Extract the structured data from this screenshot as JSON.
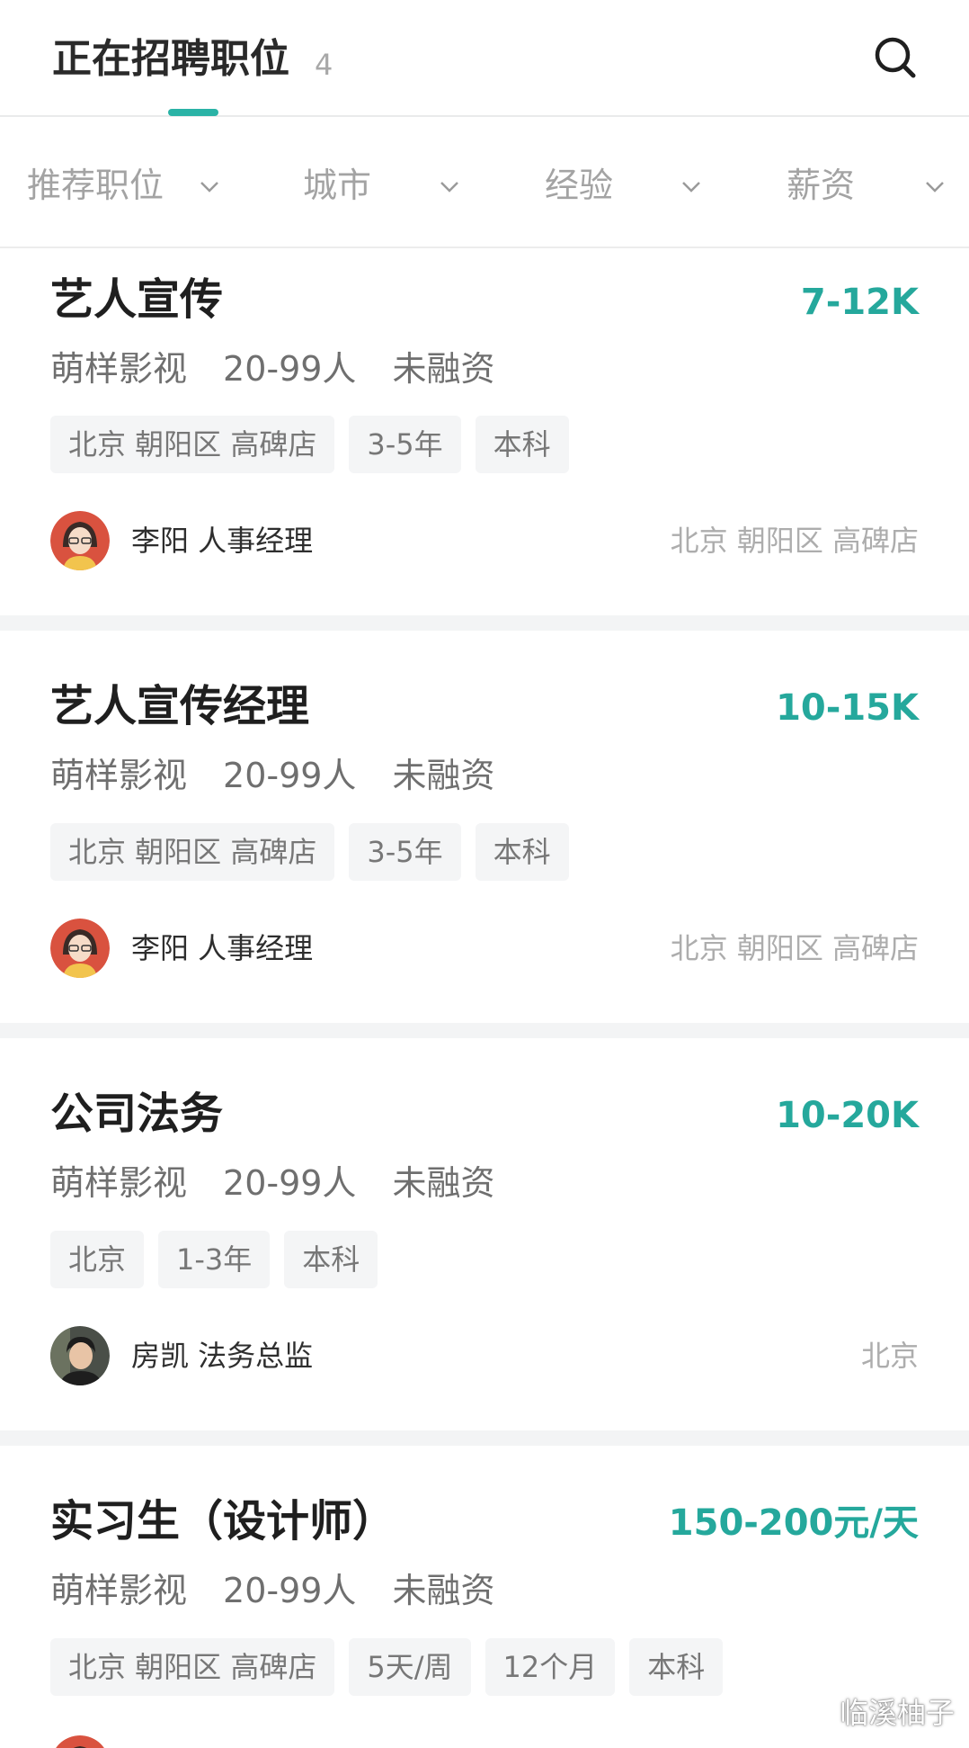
{
  "header": {
    "title": "正在招聘职位",
    "count": "4"
  },
  "filters": [
    {
      "label": "推荐职位"
    },
    {
      "label": "城市"
    },
    {
      "label": "经验"
    },
    {
      "label": "薪资"
    }
  ],
  "jobs": [
    {
      "title": "艺人宣传",
      "salary": "7-12K",
      "company": "萌样影视",
      "size": "20-99人",
      "funding": "未融资",
      "tags": [
        "北京 朝阳区 高碑店",
        "3-5年",
        "本科"
      ],
      "recruiter": "李阳 人事经理",
      "location": "北京 朝阳区 高碑店"
    },
    {
      "title": "艺人宣传经理",
      "salary": "10-15K",
      "company": "萌样影视",
      "size": "20-99人",
      "funding": "未融资",
      "tags": [
        "北京 朝阳区 高碑店",
        "3-5年",
        "本科"
      ],
      "recruiter": "李阳 人事经理",
      "location": "北京 朝阳区 高碑店"
    },
    {
      "title": "公司法务",
      "salary": "10-20K",
      "company": "萌样影视",
      "size": "20-99人",
      "funding": "未融资",
      "tags": [
        "北京",
        "1-3年",
        "本科"
      ],
      "recruiter": "房凯 法务总监",
      "location": "北京"
    },
    {
      "title": "实习生（设计师）",
      "salary": "150-200元/天",
      "company": "萌样影视",
      "size": "20-99人",
      "funding": "未融资",
      "tags": [
        "北京 朝阳区 高碑店",
        "5天/周",
        "12个月",
        "本科"
      ]
    }
  ],
  "watermark": "临溪柚子",
  "colors": {
    "accent": "#2ab3a6",
    "salary": "#25a89c",
    "background": "#f3f4f5"
  },
  "icons": {
    "search": "search-icon",
    "filter_chevron": "chevron-down-icon"
  }
}
